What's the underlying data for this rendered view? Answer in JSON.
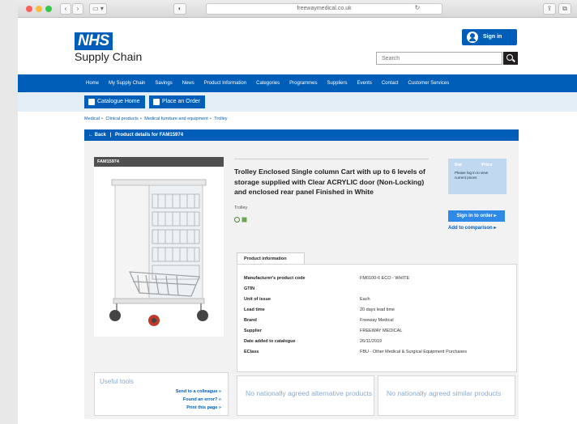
{
  "browser": {
    "url": "freewaymedical.co.uk"
  },
  "header": {
    "logo": "NHS",
    "org_name": "Supply Chain",
    "signin_label": "Sign in",
    "search_placeholder": "Search"
  },
  "nav": {
    "items": [
      "Home",
      "My Supply Chain",
      "Savings",
      "News",
      "Product Information",
      "Categories",
      "Programmes",
      "Suppliers",
      "Events",
      "Contact",
      "Customer Services"
    ]
  },
  "subbar": {
    "catalogue_home": "Catalogue Home",
    "place_order": "Place an Order"
  },
  "breadcrumb": [
    "Medical",
    "Clinical products",
    "Medical furniture and equipment",
    "Trolley"
  ],
  "back_bar": {
    "back_label": "Back",
    "details_label": "Product details for FAM15974"
  },
  "product": {
    "code_tag": "FAM15974",
    "title": "Trolley Enclosed Single column Cart with up to 6 levels of storage supplied with Clear ACRYLIC door (Non-Locking) and enclosed rear panel Finished in White",
    "category": "Trolley"
  },
  "pricing": {
    "col_left": "Bar",
    "col_right": "Price",
    "note": "Please log in to view current prices",
    "signin_order": "Sign in to order",
    "add_compare": "Add to comparison"
  },
  "info": {
    "tab_label": "Product information",
    "rows": [
      {
        "key": "Manufacturer's product code",
        "value": "FM0100-6 ECO - WHITE"
      },
      {
        "key": "GTIN",
        "value": ""
      },
      {
        "key": "Unit of issue",
        "value": "Each"
      },
      {
        "key": "Lead time",
        "value": "20 days lead time"
      },
      {
        "key": "Brand",
        "value": "Freeway Medical"
      },
      {
        "key": "Supplier",
        "value": "FREEWAY MEDICAL"
      },
      {
        "key": "Date added to catalogue",
        "value": "26/11/2019"
      },
      {
        "key": "EClass",
        "value": "FBU - Other Medical & Surgical Equipment Purchases"
      }
    ]
  },
  "useful_tools": {
    "heading": "Useful tools",
    "links": [
      "Send to a colleague",
      "Found an error?",
      "Print this page"
    ]
  },
  "alternatives": {
    "left": "No nationally agreed alternative products",
    "right": "No nationally agreed similar products"
  },
  "colors": {
    "nhs_blue": "#005eb8",
    "light_blue": "#e4eef7",
    "muted_blue": "#8aaad0"
  }
}
